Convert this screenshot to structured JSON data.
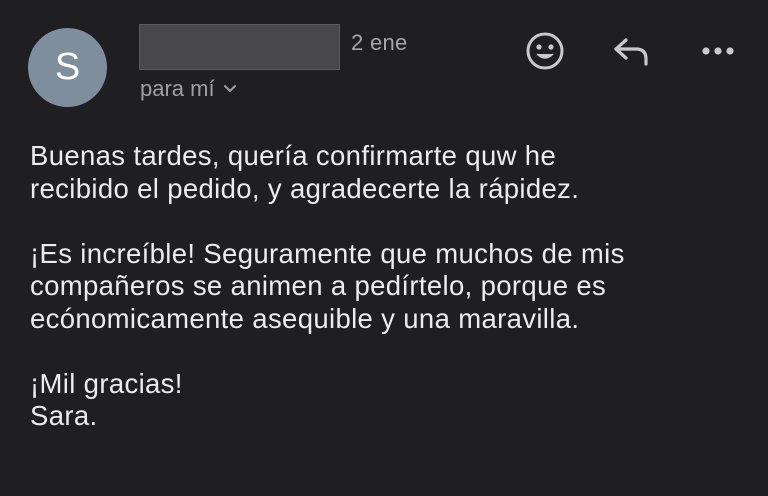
{
  "header": {
    "avatar_initial": "S",
    "sender_name": "",
    "date": "2 ene",
    "recipient_label": "para mí",
    "icons": {
      "emoji": "smiley-face-icon",
      "reply": "reply-arrow-icon",
      "more": "more-dots-icon",
      "chevron": "chevron-down-icon"
    }
  },
  "message": {
    "paragraphs": [
      "Buenas tardes, quería confirmarte quw he\nrecibido el pedido, y agradecerte la rápidez.",
      "¡Es increíble! Seguramente que muchos de mis\ncompañeros se animen a pedírtelo, porque es\necónomicamente asequible y una maravilla.",
      "¡Mil gracias!\nSara."
    ]
  },
  "colors": {
    "background": "#1f1f21",
    "avatar": "#7e8e9c",
    "text": "#ececee",
    "secondary_text": "#a6a6aa",
    "redaction": "#48484a"
  }
}
